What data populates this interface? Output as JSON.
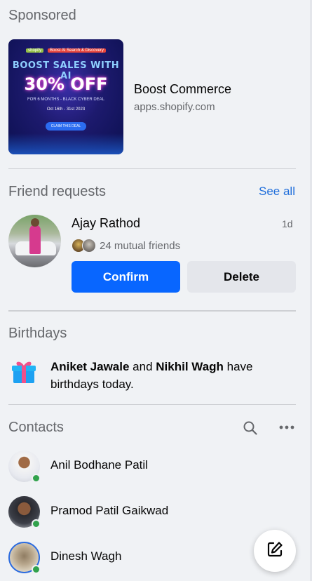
{
  "sponsored": {
    "title": "Sponsored",
    "ad": {
      "brand_shopify": "shopify",
      "brand_partner": "Boost AI Search & Discovery",
      "headline": "BOOST SALES WITH AI",
      "offer": "30% OFF",
      "sub": "FOR 6 MONTHS - BLACK CYBER DEAL",
      "dates": "Oct 16th - 31st 2023",
      "cta": "CLAIM THIS DEAL",
      "name": "Boost Commerce",
      "domain": "apps.shopify.com"
    }
  },
  "friend_requests": {
    "title": "Friend requests",
    "see_all": "See all",
    "request": {
      "name": "Ajay Rathod",
      "time": "1d",
      "mutual": "24 mutual friends",
      "confirm_label": "Confirm",
      "delete_label": "Delete"
    }
  },
  "birthdays": {
    "title": "Birthdays",
    "person1": "Aniket Jawale",
    "joiner": " and ",
    "person2": "Nikhil Wagh",
    "suffix": " have birthdays today."
  },
  "contacts": {
    "title": "Contacts",
    "items": [
      {
        "name": "Anil Bodhane Patil",
        "online": true
      },
      {
        "name": "Pramod Patil Gaikwad",
        "online": true
      },
      {
        "name": "Dinesh Wagh",
        "online": true
      }
    ]
  },
  "icons": {
    "search": "search-icon",
    "more": "more-horizontal-icon",
    "compose": "compose-icon",
    "gift": "gift-icon"
  },
  "colors": {
    "accent": "#0866ff",
    "link": "#216fdb",
    "online": "#31a24c",
    "background": "#f0f2f5"
  }
}
